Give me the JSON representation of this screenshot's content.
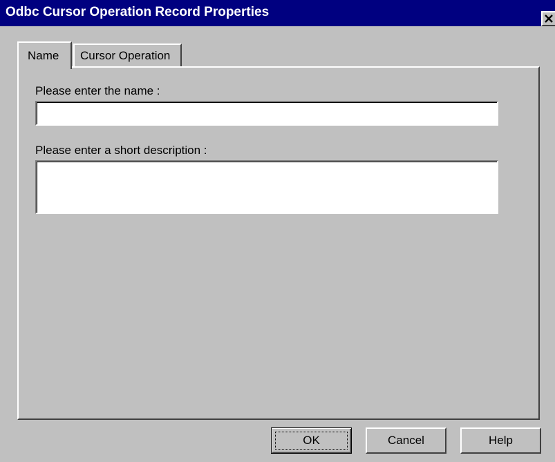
{
  "window": {
    "title": "Odbc Cursor Operation Record Properties",
    "close_icon": "close-icon",
    "title_bar_color": "#000080",
    "face_color": "#c0c0c0"
  },
  "tabs": [
    {
      "label": "Name",
      "selected": true
    },
    {
      "label": "Cursor Operation",
      "selected": false
    }
  ],
  "form": {
    "name_label": "Please enter the name :",
    "name_value": "",
    "description_label": "Please enter a short description :",
    "description_value": ""
  },
  "buttons": {
    "ok_label": "OK",
    "cancel_label": "Cancel",
    "help_label": "Help"
  }
}
